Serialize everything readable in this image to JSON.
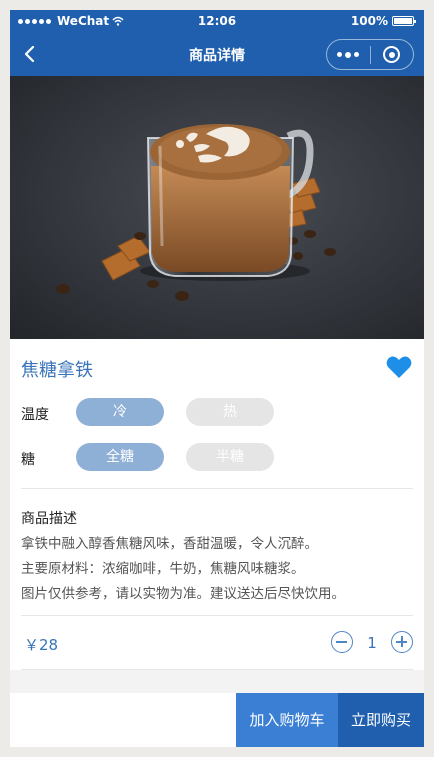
{
  "status_bar": {
    "carrier": "WeChat",
    "time": "12:06",
    "battery": "100%"
  },
  "nav": {
    "title": "商品详情"
  },
  "product": {
    "name": "焦糖拿铁",
    "favorited": true,
    "options": {
      "temperature": {
        "label": "温度",
        "choices": [
          "冷",
          "热"
        ],
        "selected": "冷"
      },
      "sugar": {
        "label": "糖",
        "choices": [
          "全糖",
          "半糖"
        ],
        "selected": "全糖"
      }
    },
    "description": {
      "title": "商品描述",
      "lines": [
        "拿铁中融入醇香焦糖风味，香甜温暖，令人沉醉。",
        "主要原材料：浓缩咖啡，牛奶，焦糖风味糖浆。",
        "图片仅供参考，请以实物为准。建议送达后尽快饮用。"
      ]
    },
    "price": "￥28",
    "quantity": "1"
  },
  "actions": {
    "add_to_cart": "加入购物车",
    "buy_now": "立即购买"
  },
  "colors": {
    "brand": "#1f5fae",
    "accent": "#3a74b8",
    "cart_button": "#3a7fd4",
    "selected_option": "#8fb0d6",
    "heart": "#1e8fe8"
  },
  "icons": {
    "back": "chevron-left-icon",
    "more": "more-dots-icon",
    "close": "capsule-close-icon",
    "favorite": "heart-icon",
    "minus": "minus-circle-icon",
    "plus": "plus-circle-icon"
  }
}
